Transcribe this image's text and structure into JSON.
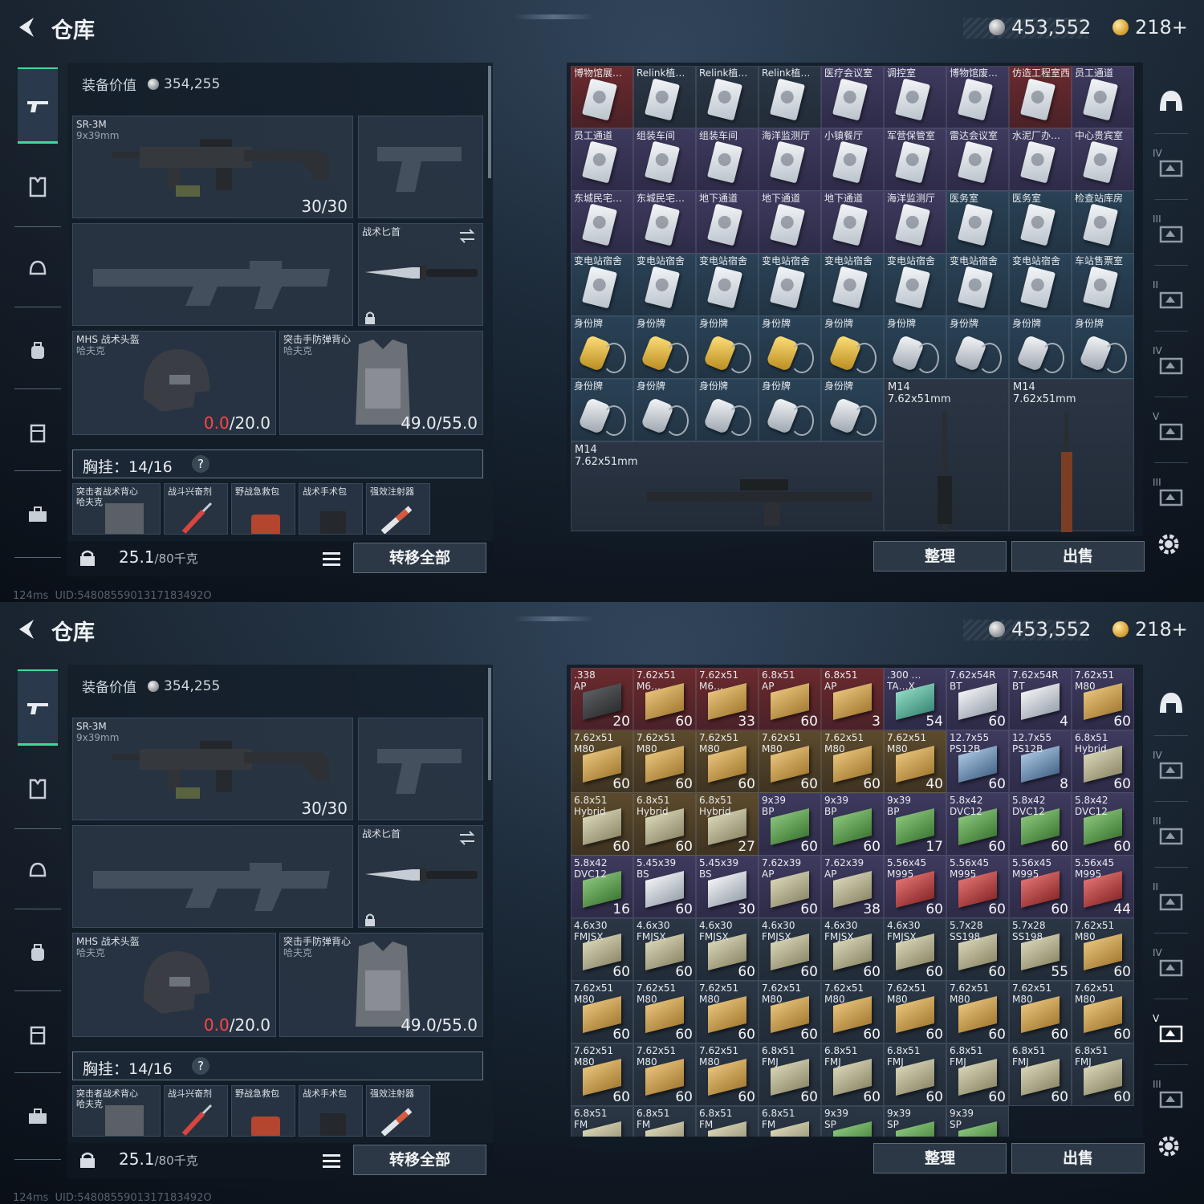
{
  "header": {
    "title": "仓库",
    "silver": "453,552",
    "gold": "218+"
  },
  "status": {
    "ping": "124ms",
    "uid": "UID:5480855901317183492O"
  },
  "left": {
    "equip_label": "装备价值",
    "equip_value": "354,255",
    "primary": {
      "name": "SR-3M",
      "caliber": "9x39mm",
      "ammo": "30/30"
    },
    "knife": {
      "name": "战术匕首"
    },
    "helmet": {
      "name": "MHS 战术头盔",
      "maker": "哈夫克",
      "dur_cur": "0.0",
      "dur_max": "/20.0"
    },
    "vest": {
      "name": "突击手防弹背心",
      "maker": "哈夫克",
      "dur": "49.0/55.0"
    },
    "chest": "胸挂：14/16",
    "help": "?",
    "chest_items": [
      {
        "name": "突击者战术背心",
        "sub": "哈夫克"
      },
      {
        "name": "战斗兴奋剂"
      },
      {
        "name": "野战急救包"
      },
      {
        "name": "战术手术包"
      },
      {
        "name": "强效注射器"
      }
    ],
    "weight": "25.1",
    "weight_max": "/80千克",
    "transfer_all": "转移全部"
  },
  "actions": {
    "sort": "整理",
    "sell": "出售"
  },
  "right_nav": [
    {
      "icon": "helmet-icon",
      "label": ""
    },
    {
      "icon": "shelf-icon",
      "label": "IV"
    },
    {
      "icon": "shelf-icon",
      "label": "III"
    },
    {
      "icon": "shelf-icon",
      "label": "II"
    },
    {
      "icon": "shelf-icon",
      "label": "IV"
    },
    {
      "icon": "shelf-icon",
      "label": "V"
    },
    {
      "icon": "shelf-icon",
      "label": "III"
    }
  ],
  "top_grid": [
    {
      "name": "博物馆展…",
      "type": "card",
      "bg": "red"
    },
    {
      "name": "Relink植…",
      "type": "card",
      "bg": "dark"
    },
    {
      "name": "Relink植…",
      "type": "card",
      "bg": "dark"
    },
    {
      "name": "Relink植…",
      "type": "card",
      "bg": "dark"
    },
    {
      "name": "医疗会议室",
      "type": "card",
      "bg": "purple"
    },
    {
      "name": "调控室",
      "type": "card",
      "bg": "purple"
    },
    {
      "name": "博物馆废…",
      "type": "card",
      "bg": "purple"
    },
    {
      "name": "仿造工程室西",
      "type": "card",
      "bg": "red"
    },
    {
      "name": "员工通道",
      "type": "card",
      "bg": "purple"
    },
    {
      "name": "员工通道",
      "type": "card",
      "bg": "purple"
    },
    {
      "name": "组装车间",
      "type": "card",
      "bg": "purple"
    },
    {
      "name": "组装车间",
      "type": "card",
      "bg": "purple"
    },
    {
      "name": "海洋监测厅",
      "type": "card",
      "bg": "purple"
    },
    {
      "name": "小镇餐厅",
      "type": "card",
      "bg": "purple"
    },
    {
      "name": "军营保管室",
      "type": "card",
      "bg": "purple"
    },
    {
      "name": "雷达会议室",
      "type": "card",
      "bg": "purple"
    },
    {
      "name": "水泥厂办…",
      "type": "card",
      "bg": "purple"
    },
    {
      "name": "中心贵宾室",
      "type": "card",
      "bg": "purple"
    },
    {
      "name": "东城民宅…",
      "type": "card",
      "bg": "purple"
    },
    {
      "name": "东城民宅…",
      "type": "card",
      "bg": "purple"
    },
    {
      "name": "地下通道",
      "type": "card",
      "bg": "purple"
    },
    {
      "name": "地下通道",
      "type": "card",
      "bg": "purple"
    },
    {
      "name": "地下通道",
      "type": "card",
      "bg": "purple"
    },
    {
      "name": "海洋监测厅",
      "type": "card",
      "bg": "purple"
    },
    {
      "name": "医务室",
      "type": "card",
      "bg": "blue"
    },
    {
      "name": "医务室",
      "type": "card",
      "bg": "blue"
    },
    {
      "name": "检查站库房",
      "type": "card",
      "bg": "blue"
    },
    {
      "name": "变电站宿舍",
      "type": "card",
      "bg": "blue"
    },
    {
      "name": "变电站宿舍",
      "type": "card",
      "bg": "blue"
    },
    {
      "name": "变电站宿舍",
      "type": "card",
      "bg": "blue"
    },
    {
      "name": "变电站宿舍",
      "type": "card",
      "bg": "blue"
    },
    {
      "name": "变电站宿舍",
      "type": "card",
      "bg": "blue"
    },
    {
      "name": "变电站宿舍",
      "type": "card",
      "bg": "blue"
    },
    {
      "name": "变电站宿舍",
      "type": "card",
      "bg": "blue"
    },
    {
      "name": "变电站宿舍",
      "type": "card",
      "bg": "blue"
    },
    {
      "name": "车站售票室",
      "type": "card",
      "bg": "blue"
    },
    {
      "name": "身份牌",
      "type": "tag-gold",
      "bg": "blue"
    },
    {
      "name": "身份牌",
      "type": "tag-gold",
      "bg": "blue"
    },
    {
      "name": "身份牌",
      "type": "tag-gold",
      "bg": "blue"
    },
    {
      "name": "身份牌",
      "type": "tag-gold",
      "bg": "blue"
    },
    {
      "name": "身份牌",
      "type": "tag-gold",
      "bg": "blue"
    },
    {
      "name": "身份牌",
      "type": "tag-silver",
      "bg": "blue"
    },
    {
      "name": "身份牌",
      "type": "tag-silver",
      "bg": "blue"
    },
    {
      "name": "身份牌",
      "type": "tag-silver",
      "bg": "blue"
    },
    {
      "name": "身份牌",
      "type": "tag-silver",
      "bg": "blue"
    },
    {
      "name": "身份牌",
      "type": "tag-silver",
      "bg": "blue"
    },
    {
      "name": "身份牌",
      "type": "tag-silver",
      "bg": "blue"
    },
    {
      "name": "身份牌",
      "type": "tag-silver",
      "bg": "blue"
    },
    {
      "name": "身份牌",
      "type": "tag-silver",
      "bg": "blue"
    },
    {
      "name": "身份牌",
      "type": "tag-silver",
      "bg": "blue"
    }
  ],
  "top_rifles": [
    {
      "name": "M14",
      "caliber": "7.62x51mm"
    },
    {
      "name": "M14",
      "caliber": "7.62x51mm"
    },
    {
      "name": "M14",
      "caliber": "7.62x51mm"
    }
  ],
  "ammo_grid": [
    {
      "n1": ".338",
      "n2": "AP",
      "q": "20",
      "bg": "red",
      "c": "dk"
    },
    {
      "n1": "7.62x51",
      "n2": "M6…",
      "q": "60",
      "bg": "red",
      "c": "y"
    },
    {
      "n1": "7.62x51",
      "n2": "M6…",
      "q": "33",
      "bg": "red",
      "c": "y"
    },
    {
      "n1": "6.8x51",
      "n2": "AP",
      "q": "60",
      "bg": "red",
      "c": "y"
    },
    {
      "n1": "6.8x51",
      "n2": "AP",
      "q": "3",
      "bg": "red",
      "c": "y"
    },
    {
      "n1": ".300 …",
      "n2": "TA…X",
      "q": "54",
      "bg": "purple",
      "c": "t"
    },
    {
      "n1": "7.62x54R",
      "n2": "BT",
      "q": "60",
      "bg": "purple",
      "c": "w"
    },
    {
      "n1": "7.62x54R",
      "n2": "BT",
      "q": "4",
      "bg": "purple",
      "c": "w"
    },
    {
      "n1": "7.62x51",
      "n2": "M80",
      "q": "60",
      "bg": "purple",
      "c": "y"
    },
    {
      "n1": "7.62x51",
      "n2": "M80",
      "q": "60",
      "bg": "gold",
      "c": "y"
    },
    {
      "n1": "7.62x51",
      "n2": "M80",
      "q": "60",
      "bg": "gold",
      "c": "y"
    },
    {
      "n1": "7.62x51",
      "n2": "M80",
      "q": "60",
      "bg": "gold",
      "c": "y"
    },
    {
      "n1": "7.62x51",
      "n2": "M80",
      "q": "60",
      "bg": "gold",
      "c": "y"
    },
    {
      "n1": "7.62x51",
      "n2": "M80",
      "q": "60",
      "bg": "gold",
      "c": "y"
    },
    {
      "n1": "7.62x51",
      "n2": "M80",
      "q": "40",
      "bg": "gold",
      "c": "y"
    },
    {
      "n1": "12.7x55",
      "n2": "PS12B",
      "q": "60",
      "bg": "purple",
      "c": "b"
    },
    {
      "n1": "12.7x55",
      "n2": "PS12B",
      "q": "8",
      "bg": "purple",
      "c": "b"
    },
    {
      "n1": "6.8x51",
      "n2": "Hybrid",
      "q": "60",
      "bg": "purple",
      "c": "gy"
    },
    {
      "n1": "6.8x51",
      "n2": "Hybrid",
      "q": "60",
      "bg": "gold",
      "c": "gy"
    },
    {
      "n1": "6.8x51",
      "n2": "Hybrid",
      "q": "60",
      "bg": "gold",
      "c": "gy"
    },
    {
      "n1": "6.8x51",
      "n2": "Hybrid",
      "q": "27",
      "bg": "gold",
      "c": "gy"
    },
    {
      "n1": "9x39",
      "n2": "BP",
      "q": "60",
      "bg": "purple",
      "c": "gr"
    },
    {
      "n1": "9x39",
      "n2": "BP",
      "q": "60",
      "bg": "purple",
      "c": "gr"
    },
    {
      "n1": "9x39",
      "n2": "BP",
      "q": "17",
      "bg": "purple",
      "c": "gr"
    },
    {
      "n1": "5.8x42",
      "n2": "DVC12",
      "q": "60",
      "bg": "purple",
      "c": "gr"
    },
    {
      "n1": "5.8x42",
      "n2": "DVC12",
      "q": "60",
      "bg": "purple",
      "c": "gr"
    },
    {
      "n1": "5.8x42",
      "n2": "DVC12",
      "q": "60",
      "bg": "purple",
      "c": "gr"
    },
    {
      "n1": "5.8x42",
      "n2": "DVC12",
      "q": "16",
      "bg": "purple",
      "c": "gr"
    },
    {
      "n1": "5.45x39",
      "n2": "BS",
      "q": "60",
      "bg": "purple",
      "c": "w"
    },
    {
      "n1": "5.45x39",
      "n2": "BS",
      "q": "30",
      "bg": "purple",
      "c": "w"
    },
    {
      "n1": "7.62x39",
      "n2": "AP",
      "q": "60",
      "bg": "purple",
      "c": "gy"
    },
    {
      "n1": "7.62x39",
      "n2": "AP",
      "q": "38",
      "bg": "purple",
      "c": "gy"
    },
    {
      "n1": "5.56x45",
      "n2": "M995",
      "q": "60",
      "bg": "purple",
      "c": "r"
    },
    {
      "n1": "5.56x45",
      "n2": "M995",
      "q": "60",
      "bg": "purple",
      "c": "r"
    },
    {
      "n1": "5.56x45",
      "n2": "M995",
      "q": "60",
      "bg": "purple",
      "c": "r"
    },
    {
      "n1": "5.56x45",
      "n2": "M995",
      "q": "44",
      "bg": "purple",
      "c": "r"
    },
    {
      "n1": "4.6x30",
      "n2": "FMJSX",
      "q": "60",
      "bg": "dark",
      "c": "gy"
    },
    {
      "n1": "4.6x30",
      "n2": "FMJSX",
      "q": "60",
      "bg": "dark",
      "c": "gy"
    },
    {
      "n1": "4.6x30",
      "n2": "FMJSX",
      "q": "60",
      "bg": "dark",
      "c": "gy"
    },
    {
      "n1": "4.6x30",
      "n2": "FMJSX",
      "q": "60",
      "bg": "dark",
      "c": "gy"
    },
    {
      "n1": "4.6x30",
      "n2": "FMJSX",
      "q": "60",
      "bg": "dark",
      "c": "gy"
    },
    {
      "n1": "4.6x30",
      "n2": "FMJSX",
      "q": "60",
      "bg": "dark",
      "c": "gy"
    },
    {
      "n1": "5.7x28",
      "n2": "SS198",
      "q": "60",
      "bg": "dark",
      "c": "gy"
    },
    {
      "n1": "5.7x28",
      "n2": "SS198",
      "q": "55",
      "bg": "dark",
      "c": "gy"
    },
    {
      "n1": "7.62x51",
      "n2": "M80",
      "q": "60",
      "bg": "dark",
      "c": "y"
    },
    {
      "n1": "7.62x51",
      "n2": "M80",
      "q": "60",
      "bg": "dark",
      "c": "y"
    },
    {
      "n1": "7.62x51",
      "n2": "M80",
      "q": "60",
      "bg": "dark",
      "c": "y"
    },
    {
      "n1": "7.62x51",
      "n2": "M80",
      "q": "60",
      "bg": "dark",
      "c": "y"
    },
    {
      "n1": "7.62x51",
      "n2": "M80",
      "q": "60",
      "bg": "dark",
      "c": "y"
    },
    {
      "n1": "7.62x51",
      "n2": "M80",
      "q": "60",
      "bg": "dark",
      "c": "y"
    },
    {
      "n1": "7.62x51",
      "n2": "M80",
      "q": "60",
      "bg": "dark",
      "c": "y"
    },
    {
      "n1": "7.62x51",
      "n2": "M80",
      "q": "60",
      "bg": "dark",
      "c": "y"
    },
    {
      "n1": "7.62x51",
      "n2": "M80",
      "q": "60",
      "bg": "dark",
      "c": "y"
    },
    {
      "n1": "7.62x51",
      "n2": "M80",
      "q": "60",
      "bg": "dark",
      "c": "y"
    },
    {
      "n1": "7.62x51",
      "n2": "M80",
      "q": "60",
      "bg": "dark",
      "c": "y"
    },
    {
      "n1": "7.62x51",
      "n2": "M80",
      "q": "60",
      "bg": "dark",
      "c": "y"
    },
    {
      "n1": "7.62x51",
      "n2": "M80",
      "q": "60",
      "bg": "dark",
      "c": "y"
    },
    {
      "n1": "6.8x51",
      "n2": "FMJ",
      "q": "60",
      "bg": "dark",
      "c": "gy"
    },
    {
      "n1": "6.8x51",
      "n2": "FMJ",
      "q": "60",
      "bg": "dark",
      "c": "gy"
    },
    {
      "n1": "6.8x51",
      "n2": "FMJ",
      "q": "60",
      "bg": "dark",
      "c": "gy"
    },
    {
      "n1": "6.8x51",
      "n2": "FMJ",
      "q": "60",
      "bg": "dark",
      "c": "gy"
    },
    {
      "n1": "6.8x51",
      "n2": "FMJ",
      "q": "60",
      "bg": "dark",
      "c": "gy"
    },
    {
      "n1": "6.8x51",
      "n2": "FMJ",
      "q": "60",
      "bg": "dark",
      "c": "gy"
    },
    {
      "n1": "6.8x51",
      "n2": "FM",
      "q": "",
      "bg": "dark",
      "c": "gy"
    },
    {
      "n1": "6.8x51",
      "n2": "FM",
      "q": "",
      "bg": "dark",
      "c": "gy"
    },
    {
      "n1": "6.8x51",
      "n2": "FM",
      "q": "",
      "bg": "dark",
      "c": "gy"
    },
    {
      "n1": "6.8x51",
      "n2": "FM",
      "q": "",
      "bg": "dark",
      "c": "gy"
    },
    {
      "n1": "9x39",
      "n2": "SP",
      "q": "",
      "bg": "dark",
      "c": "gr"
    },
    {
      "n1": "9x39",
      "n2": "SP",
      "q": "",
      "bg": "dark",
      "c": "gr"
    },
    {
      "n1": "9x39",
      "n2": "SP",
      "q": "",
      "bg": "dark",
      "c": "gr"
    }
  ],
  "colors": {
    "accent": "#3fd89b",
    "danger": "#ff4545"
  }
}
